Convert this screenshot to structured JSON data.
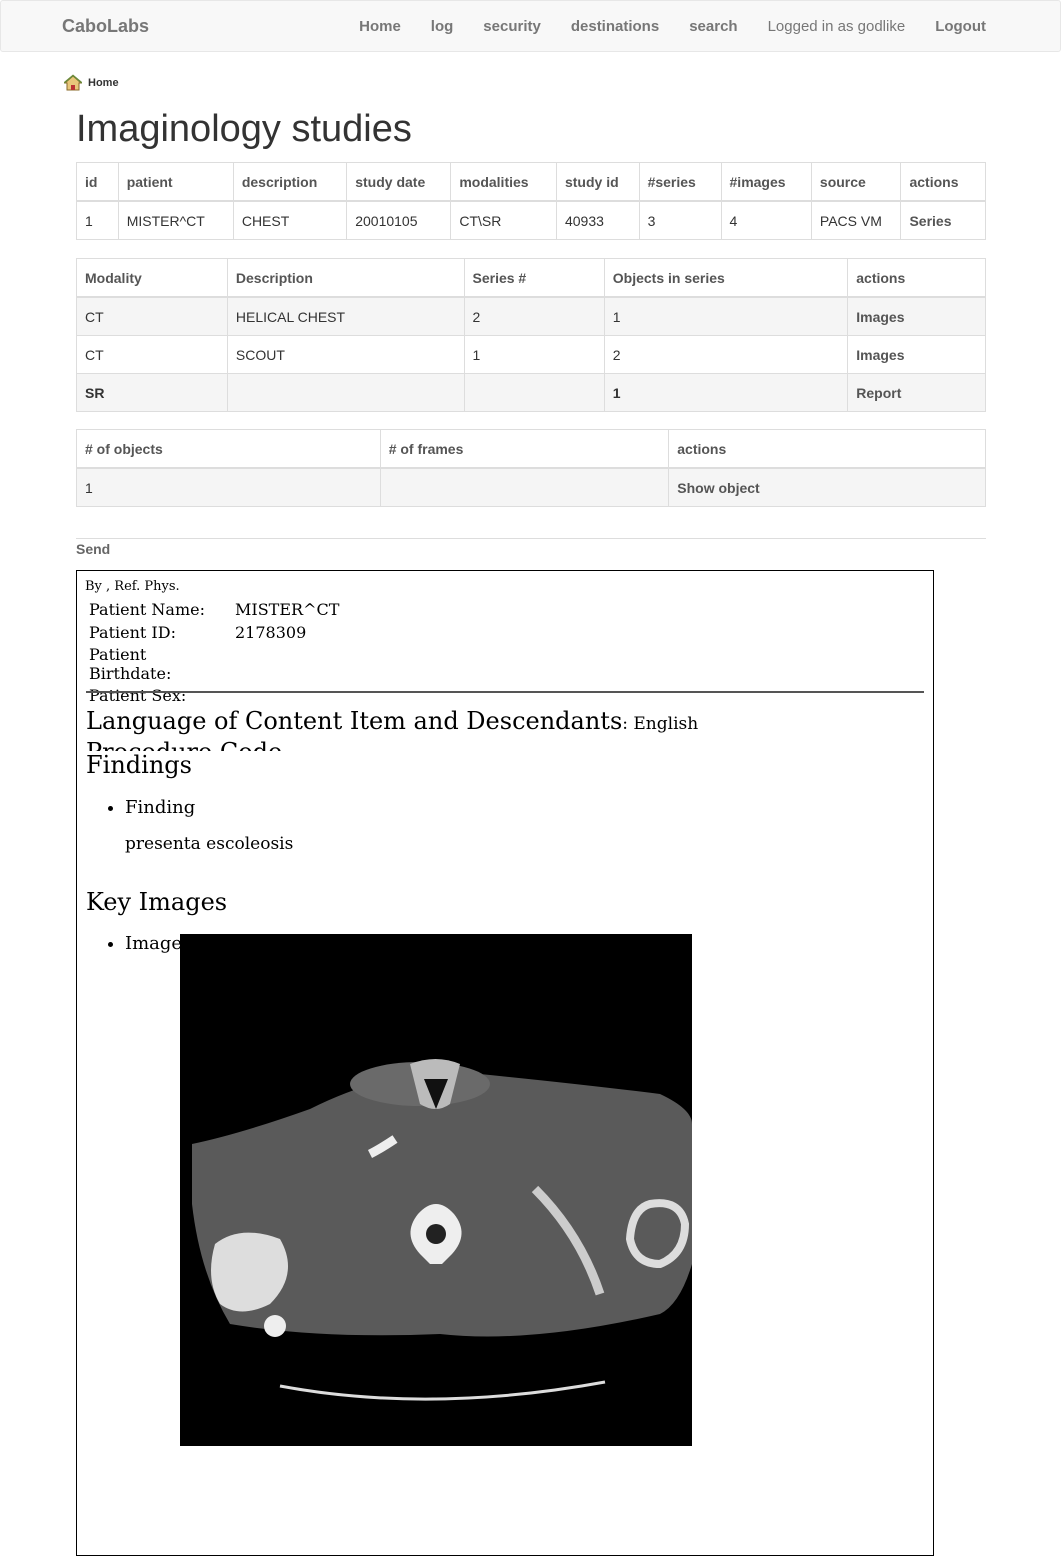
{
  "navbar": {
    "brand": "CaboLabs",
    "links": [
      "Home",
      "log",
      "security",
      "destinations",
      "search"
    ],
    "logged_in": "Logged in as godlike",
    "logout": "Logout"
  },
  "breadcrumb": {
    "home": "Home"
  },
  "page_title": "Imaginology studies",
  "studies": {
    "headers": [
      "id",
      "patient",
      "description",
      "study date",
      "modalities",
      "study id",
      "#series",
      "#images",
      "source",
      "actions"
    ],
    "rows": [
      [
        "1",
        "MISTER^CT",
        "CHEST",
        "20010105",
        "CT\\SR",
        "40933",
        "3",
        "4",
        "PACS VM",
        "Series"
      ]
    ]
  },
  "series": {
    "headers": [
      "Modality",
      "Description",
      "Series #",
      "Objects in series",
      "actions"
    ],
    "rows": [
      [
        "CT",
        "HELICAL CHEST",
        "2",
        "1",
        "Images"
      ],
      [
        "CT",
        "SCOUT",
        "1",
        "2",
        "Images"
      ],
      [
        "SR",
        "",
        "",
        "1",
        "Report"
      ]
    ]
  },
  "objects": {
    "headers": [
      "# of objects",
      "# of frames",
      "actions"
    ],
    "rows": [
      [
        "1",
        "",
        "Show object"
      ]
    ]
  },
  "send_label": "Send",
  "report": {
    "by": "By , Ref. Phys.",
    "patient_fields": [
      {
        "k": "Patient Name:",
        "v": "MISTER^CT"
      },
      {
        "k": "Patient ID:",
        "v": "2178309"
      },
      {
        "k": "Patient Birthdate:",
        "v": ""
      },
      {
        "k": "Patient Sex:",
        "v": ""
      }
    ],
    "language_heading": "Language of Content Item and Descendants",
    "language_value": ": English",
    "procedure_code": "Procedure Code",
    "findings_heading": "Findings",
    "finding_item": "Finding",
    "finding_text": "presenta escoleosis",
    "key_images_heading": "Key Images",
    "image_item": "Image"
  }
}
